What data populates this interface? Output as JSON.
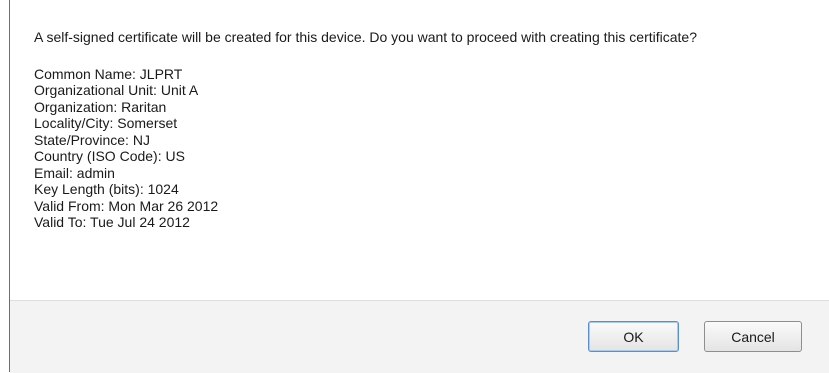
{
  "dialog": {
    "message": "A self-signed certificate will be created for this device. Do you want to proceed with creating this certificate?",
    "fields": [
      "Common Name: JLPRT",
      "Organizational Unit: Unit A",
      "Organization: Raritan",
      "Locality/City: Somerset",
      "State/Province: NJ",
      "Country (ISO Code): US",
      "Email: admin",
      "Key Length (bits): 1024",
      "Valid From: Mon Mar 26 2012",
      "Valid To: Tue Jul 24 2012"
    ],
    "buttons": {
      "ok": "OK",
      "cancel": "Cancel"
    }
  }
}
